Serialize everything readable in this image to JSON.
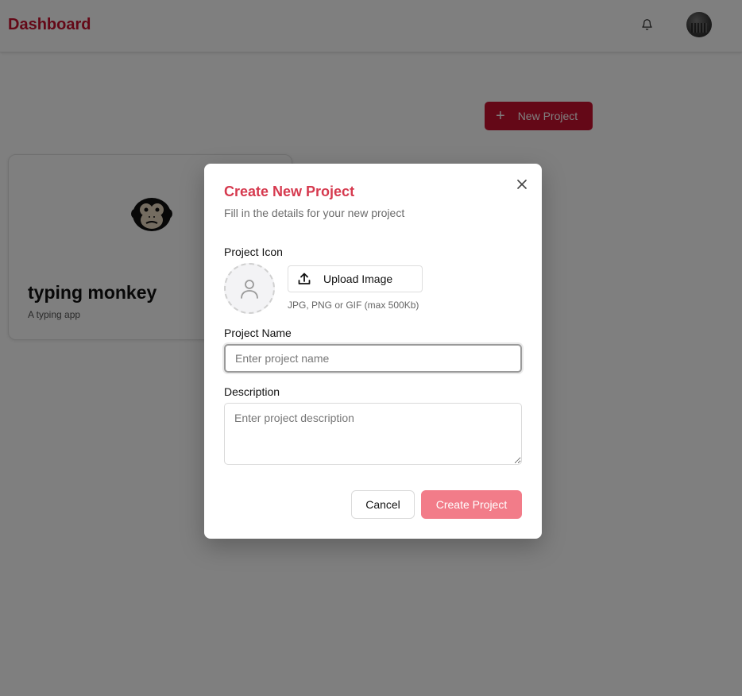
{
  "header": {
    "brand": "Dashboard",
    "brand_color": "#c8102e",
    "bell_icon": "bell-icon",
    "avatar_icon": "user-avatar"
  },
  "main": {
    "new_project_label": "New Project",
    "new_project_icon": "plus-icon",
    "projects": [
      {
        "title": "typing monkey",
        "description": "A typing app",
        "icon": "monkey-face-icon"
      }
    ]
  },
  "modal": {
    "title": "Create New Project",
    "subtitle": "Fill in the details for your new project",
    "close_icon": "close-icon",
    "icon_label": "Project Icon",
    "upload_label": "Upload Image",
    "upload_icon": "upload-icon",
    "upload_hint": "JPG, PNG or GIF (max 500Kb)",
    "name_label": "Project Name",
    "name_value": "",
    "name_placeholder": "Enter project name",
    "description_label": "Description",
    "description_value": "",
    "description_placeholder": "Enter project description",
    "cancel_label": "Cancel",
    "create_label": "Create Project",
    "accent_color": "#d63a4f",
    "create_button_color": "#f27c89"
  }
}
